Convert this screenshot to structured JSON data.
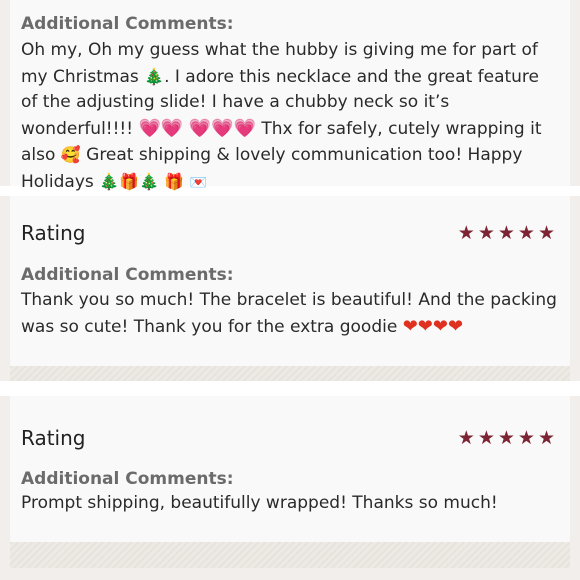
{
  "review1": {
    "comments_heading": "Additional Comments:",
    "text_a": "Oh my, Oh my guess what the hubby is giving me for part of my Christmas",
    "text_b": ". I adore this necklace and the great feature of the adjusting slide! I have a chubby neck so it’s wonderful!!!!",
    "text_c": "Thx for safely, cutely wrapping it also",
    "text_d": "Great shipping & lovely communication too! Happy Holidays"
  },
  "review2": {
    "rating_label": "Rating",
    "stars": 5,
    "comments_heading": "Additional Comments:",
    "text": "Thank you so much! The bracelet is beautiful! And the packing was so cute! Thank you for the extra goodie"
  },
  "review3": {
    "rating_label": "Rating",
    "stars": 5,
    "comments_heading": "Additional Comments:",
    "text": "Prompt shipping, beautifully wrapped! Thanks so much!"
  },
  "colors": {
    "star": "#7d2434",
    "heading": "#6b6b6b",
    "card_bg": "#f9f9f9"
  },
  "icons": [
    "christmas-tree-icon",
    "pink-heart-icon",
    "smiling-face-with-hearts-icon",
    "gift-icon",
    "envelope-heart-icon",
    "red-heart-icon",
    "star-icon"
  ]
}
